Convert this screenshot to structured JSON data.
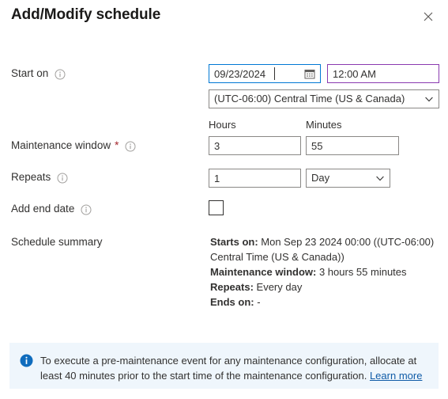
{
  "header": {
    "title": "Add/Modify schedule",
    "close_icon": "close-icon"
  },
  "fields": {
    "start_on": {
      "label": "Start on",
      "info_icon": "info-icon",
      "date_value": "09/23/2024",
      "date_placeholder": "mm/dd/yyyy",
      "calendar_icon": "calendar-icon",
      "time_value": "12:00 AM",
      "time_placeholder": "hh:mm AM",
      "timezone_value": "(UTC-06:00) Central Time (US & Canada)",
      "timezone_chevron_icon": "chevron-down-icon"
    },
    "maintenance_window": {
      "label": "Maintenance window",
      "required_mark": "*",
      "info_icon": "info-icon",
      "hours_header": "Hours",
      "minutes_header": "Minutes",
      "hours_value": "3",
      "minutes_value": "55"
    },
    "repeats": {
      "label": "Repeats",
      "info_icon": "info-icon",
      "count_value": "1",
      "unit_value": "Day",
      "unit_chevron_icon": "chevron-down-icon"
    },
    "add_end_date": {
      "label": "Add end date",
      "info_icon": "info-icon",
      "checked": false
    },
    "schedule_summary": {
      "label": "Schedule summary",
      "lines": [
        {
          "key": "Starts on:",
          "value": " Mon Sep 23 2024 00:00 ((UTC-06:00) Central Time (US & Canada))"
        },
        {
          "key": "Maintenance window:",
          "value": " 3 hours 55 minutes"
        },
        {
          "key": "Repeats:",
          "value": " Every day"
        },
        {
          "key": "Ends on:",
          "value": " -"
        }
      ]
    }
  },
  "banner": {
    "icon": "info-circle-icon",
    "text": "To execute a pre-maintenance event for any maintenance configuration, allocate at least 40 minutes prior to the start time of the maintenance configuration. ",
    "link_text": "Learn more"
  },
  "colors": {
    "focus_blue": "#0078d4",
    "accent_purple": "#8a3ab0",
    "required_red": "#a4262c",
    "banner_bg": "#eff6fc",
    "banner_icon": "#0f6cbd",
    "link": "#0f5ba7"
  }
}
